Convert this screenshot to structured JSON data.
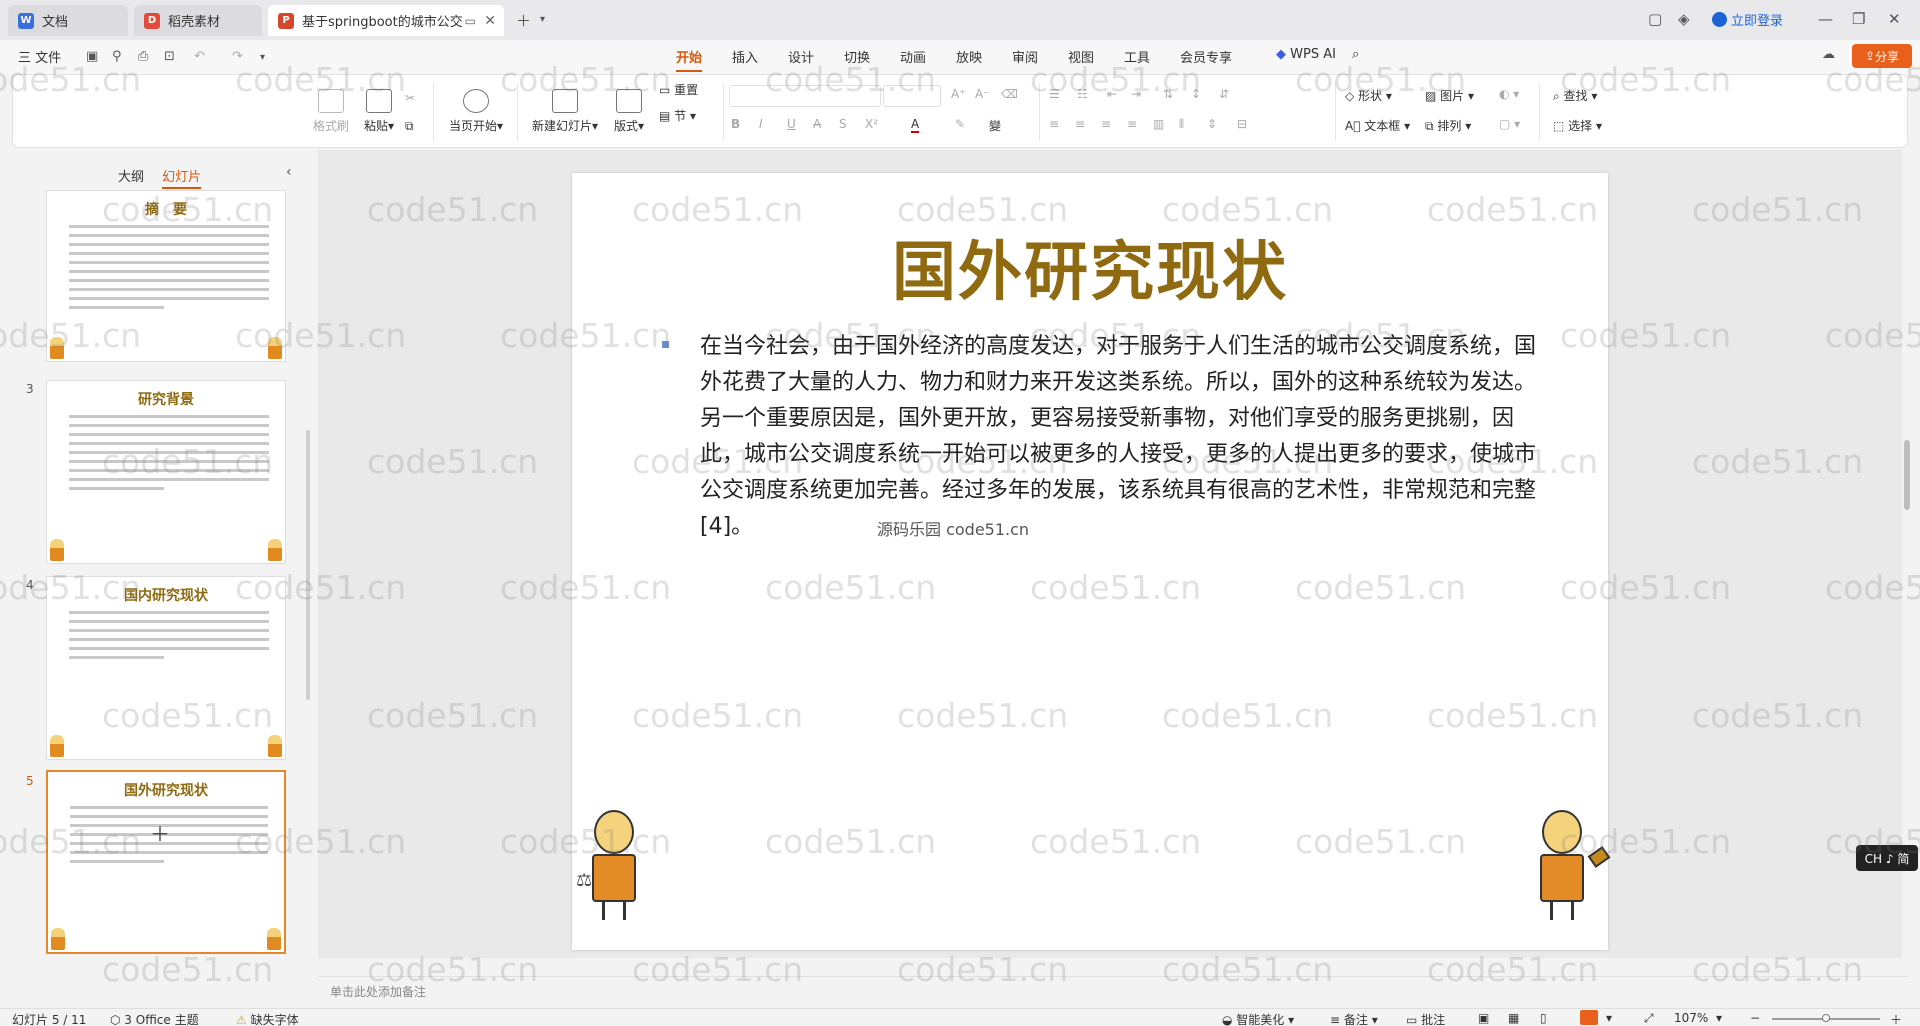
{
  "tabs": [
    {
      "label": "文档",
      "icon": "doc-icon",
      "color": "#3b6fe0"
    },
    {
      "label": "稻壳素材",
      "icon": "docer-icon",
      "color": "#e24a3b"
    },
    {
      "label": "基于springboot的城市公交",
      "icon": "ppt-icon",
      "color": "#d4472d"
    }
  ],
  "login_label": "立即登录",
  "menu": {
    "file": "三 文件",
    "tabs": [
      "开始",
      "插入",
      "设计",
      "切换",
      "动画",
      "放映",
      "审阅",
      "视图",
      "工具",
      "会员专享"
    ],
    "active": "开始",
    "wps_ai": "WPS AI",
    "share": "分享"
  },
  "ribbon": {
    "format_painter": "格式刷",
    "paste": "粘贴",
    "play_from_current": "当页开始",
    "new_slide": "新建幻灯片",
    "layout": "版式",
    "reset": "重置",
    "section": "节",
    "shape": "形状",
    "picture": "图片",
    "textbox": "文本框",
    "arrange": "排列",
    "find": "查找",
    "select": "选择"
  },
  "panel": {
    "outline_tab": "大纲",
    "slides_tab": "幻灯片",
    "slides": [
      {
        "num": "",
        "title": "摘　要",
        "lines": 10
      },
      {
        "num": "3",
        "title": "研究背景",
        "lines": 9
      },
      {
        "num": "4",
        "title": "国内研究现状",
        "lines": 6
      },
      {
        "num": "5",
        "title": "国外研究现状",
        "lines": 7,
        "selected": true
      }
    ]
  },
  "slide": {
    "title": "国外研究现状",
    "body": "在当今社会，由于国外经济的高度发达，对于服务于人们生活的城市公交调度系统，国外花费了大量的人力、物力和财力来开发这类系统。所以，国外的这种系统较为发达。另一个重要原因是，国外更开放，更容易接受新事物，对他们享受的服务更挑剔，因此，城市公交调度系统一开始可以被更多的人接受，更多的人提出更多的要求，使城市公交调度系统更加完善。经过多年的发展，该系统具有很高的艺术性，非常规范和完整[4]。",
    "overlay_watermark": "源码乐园 code51.cn"
  },
  "notes_placeholder": "单击此处添加备注",
  "status": {
    "slide_counter": "幻灯片 5 / 11",
    "theme": "3 Office 主题",
    "missing_font": "缺失字体",
    "beautify": "智能美化",
    "notes": "备注",
    "comments": "批注",
    "zoom": "107%"
  },
  "ime": "CH ♪ 简",
  "watermark_text": "code51.cn"
}
